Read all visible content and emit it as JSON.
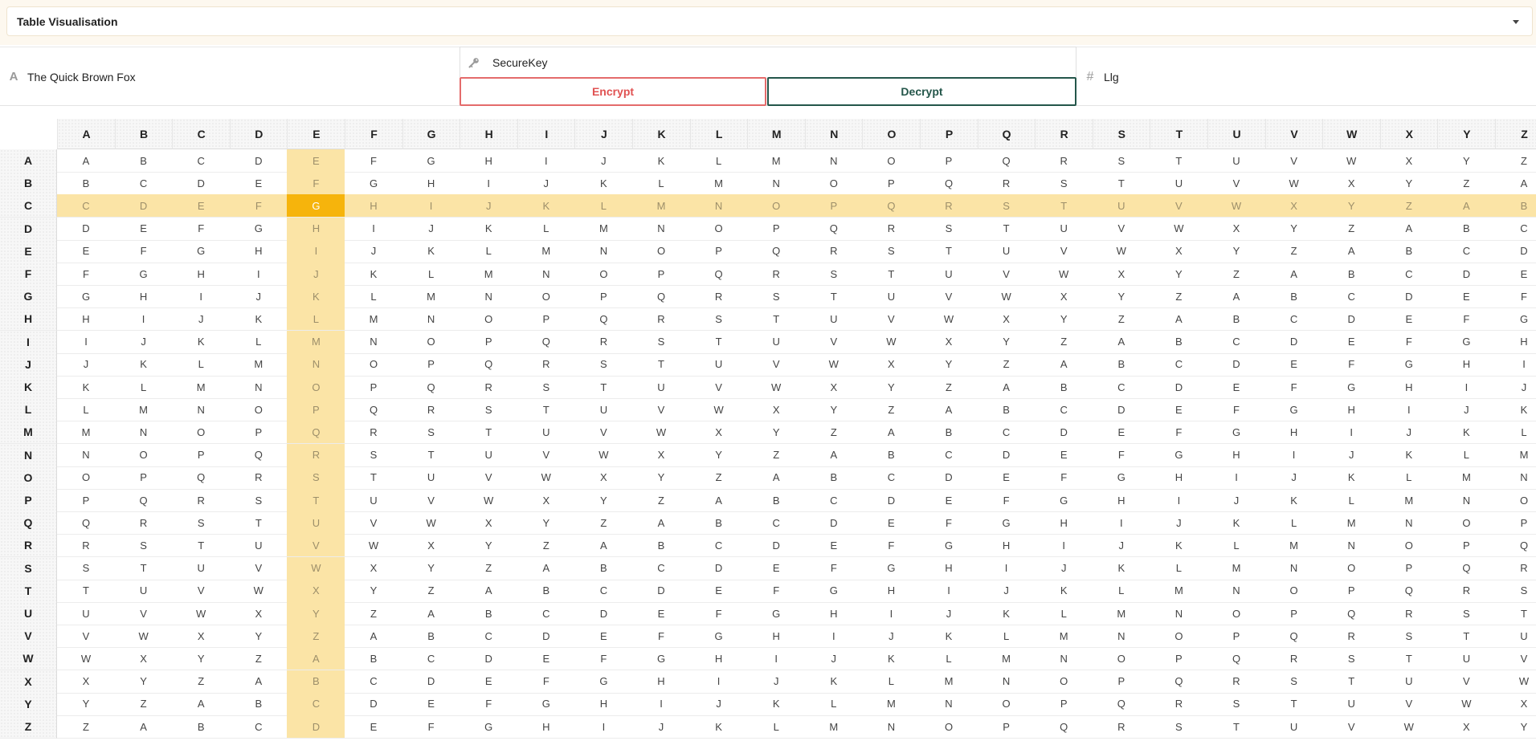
{
  "visualisation_select": {
    "selected": "Table Visualisation"
  },
  "plaintext_field": {
    "icon": "letter-a-icon",
    "value": "The Quick Brown Fox"
  },
  "key_field": {
    "icon": "key-icon",
    "value": "SecureKey"
  },
  "actions": {
    "encrypt_label": "Encrypt",
    "decrypt_label": "Decrypt"
  },
  "output_field": {
    "icon": "hash-icon",
    "value": "Llg"
  },
  "colors": {
    "encrypt": "#e05252",
    "decrypt": "#24564a",
    "highlight": "#fbe4a6",
    "intersection": "#f6b40c"
  },
  "tabula_recta": {
    "alphabet": [
      "A",
      "B",
      "C",
      "D",
      "E",
      "F",
      "G",
      "H",
      "I",
      "J",
      "K",
      "L",
      "M",
      "N",
      "O",
      "P",
      "Q",
      "R",
      "S",
      "T",
      "U",
      "V",
      "W",
      "X",
      "Y",
      "Z"
    ],
    "highlighted_row": "C",
    "highlighted_column": "E",
    "intersection": "G"
  }
}
